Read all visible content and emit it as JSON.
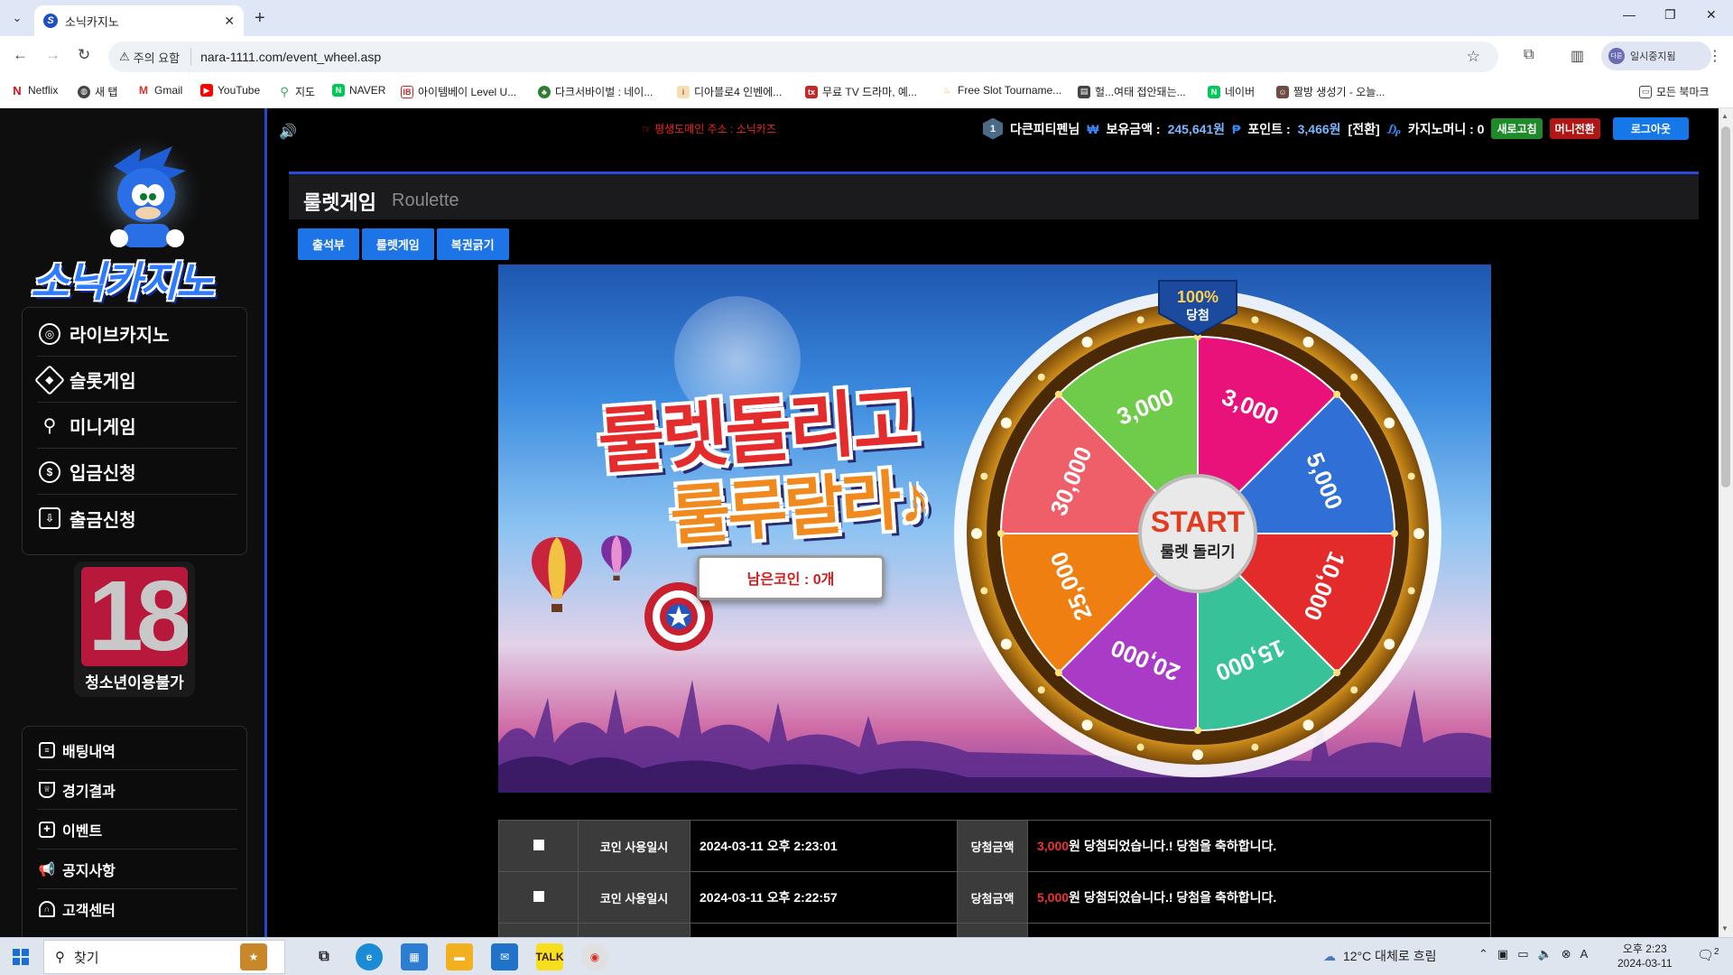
{
  "browser": {
    "tab_title": "소닉카지노",
    "tab_favicon": "S",
    "new_tab": "+",
    "warning_label": "주의 요함",
    "url": "nara-1111.com/event_wheel.asp",
    "profile_name": "일시중지됨",
    "profile_avatar": "다른",
    "bookmarks": [
      {
        "label": "Netflix",
        "icon": "netflix-icon",
        "color": "#e50914"
      },
      {
        "label": "새 탭",
        "icon": "globe-icon",
        "color": "#444444"
      },
      {
        "label": "Gmail",
        "icon": "gmail-icon",
        "color": "#d93025"
      },
      {
        "label": "YouTube",
        "icon": "youtube-icon",
        "color": "#ff0000"
      },
      {
        "label": "지도",
        "icon": "maps-icon",
        "color": "#34a853"
      },
      {
        "label": "NAVER",
        "icon": "naver-icon",
        "color": "#03c75a"
      },
      {
        "label": "아이템베이 Level U...",
        "icon": "itembay-icon",
        "color": "#c62828"
      },
      {
        "label": "다크서바이벌 : 네이...",
        "icon": "leaf-icon",
        "color": "#2e7d32"
      },
      {
        "label": "디아블로4 인벤에...",
        "icon": "inven-icon",
        "color": "#8d6e63"
      },
      {
        "label": "무료 TV 드라마, 예...",
        "icon": "tv-icon",
        "color": "#c62828"
      },
      {
        "label": "Free Slot Tourname...",
        "icon": "slot-icon",
        "color": "#f9a825"
      },
      {
        "label": "헐...여태 접안돼는...",
        "icon": "news-icon",
        "color": "#424242"
      },
      {
        "label": "네이버",
        "icon": "naver-icon",
        "color": "#03c75a"
      },
      {
        "label": "짤방 생성기 - 오늘...",
        "icon": "meme-icon",
        "color": "#6d4c41"
      }
    ],
    "all_bookmarks": "모든 북마크"
  },
  "sidebar": {
    "logo_text": "소닉카지노",
    "menu": [
      {
        "label": "라이브카지노",
        "icon": "casino-chip-icon"
      },
      {
        "label": "슬롯게임",
        "icon": "diamond-icon"
      },
      {
        "label": "미니게임",
        "icon": "joystick-icon"
      },
      {
        "label": "입금신청",
        "icon": "dollar-coin-icon"
      },
      {
        "label": "출금신청",
        "icon": "withdraw-icon"
      }
    ],
    "age_number": "18",
    "age_label": "청소년이용불가",
    "menu2": [
      {
        "label": "배팅내역",
        "icon": "receipt-icon"
      },
      {
        "label": "경기결과",
        "icon": "trophy-icon"
      },
      {
        "label": "이벤트",
        "icon": "gift-icon"
      },
      {
        "label": "공지사항",
        "icon": "megaphone-icon"
      },
      {
        "label": "고객센터",
        "icon": "headset-icon"
      }
    ]
  },
  "topbar": {
    "notice": "☞ 평생도메인 주소 : 소닉카즈",
    "level": "1",
    "username": "다큰피티펜님",
    "balance_label": "보유금액 :",
    "balance_value": "245,641원",
    "point_label": "포인트 :",
    "point_value": "3,466원",
    "point_convert": "[전환]",
    "casino_money_label": "카지노머니 : 0",
    "refresh_button": "새로고침",
    "money_convert_button": "머니전환",
    "logout_button": "로그아웃",
    "colors": {
      "green": "#1f8a2a",
      "red": "#b01616",
      "blue": "#1677e8"
    }
  },
  "main": {
    "title": "룰렛게임",
    "title_en": "Roulette",
    "tabs": [
      "출석부",
      "룰렛게임",
      "복권긁기"
    ],
    "banner": {
      "headline1": "룰렛돌리고",
      "headline2": "룰루랄라♪",
      "coins_label": "남은코인 : 0개",
      "badge_percent": "100%",
      "badge_text": "당첨",
      "start_label": "START",
      "start_sub": "룰렛 돌리기",
      "segments": [
        {
          "label": "3,000",
          "color": "#e8127a"
        },
        {
          "label": "5,000",
          "color": "#2f6fd6"
        },
        {
          "label": "10,000",
          "color": "#e32b2b"
        },
        {
          "label": "15,000",
          "color": "#38c29a"
        },
        {
          "label": "20,000",
          "color": "#a93bc6"
        },
        {
          "label": "25,000",
          "color": "#f07f12"
        },
        {
          "label": "30,000",
          "color": "#ee5f6a"
        },
        {
          "label": "3,000",
          "color": "#6fcb4a"
        }
      ]
    },
    "history": [
      {
        "used_label": "코인 사용일시",
        "date": "2024-03-11 오후 2:23:01",
        "win_label": "당첨금액",
        "amount": "3,000",
        "message": "원 당첨되었습니다.! 당첨을 축하합니다."
      },
      {
        "used_label": "코인 사용일시",
        "date": "2024-03-11 오후 2:22:57",
        "win_label": "당첨금액",
        "amount": "5,000",
        "message": "원 당첨되었습니다.! 당첨을 축하합니다."
      }
    ]
  },
  "taskbar": {
    "search_placeholder": "찾기",
    "weather": "12°C 대체로 흐림",
    "time": "오후 2:23",
    "date": "2024-03-11",
    "notification_count": "2",
    "input_lang": "A"
  }
}
